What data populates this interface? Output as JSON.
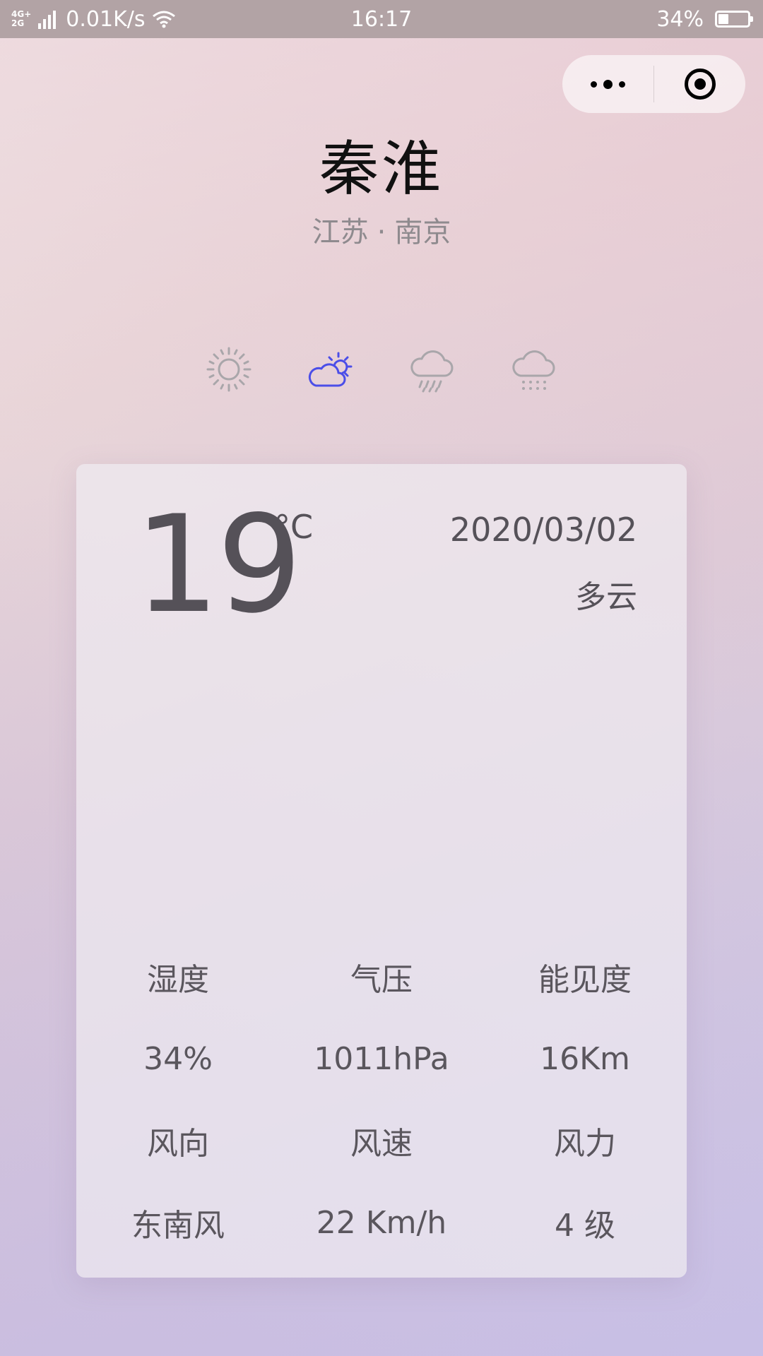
{
  "status_bar": {
    "network_type_top": "4G+",
    "network_type_bottom": "2G",
    "net_speed": "0.01K/s",
    "time": "16:17",
    "battery_percent": "34%",
    "battery_level": 0.34
  },
  "header": {
    "city": "秦淮",
    "province": "江苏",
    "separator": "·",
    "city_parent": "南京"
  },
  "weather_icons": [
    {
      "icon": "sun-icon",
      "active": false
    },
    {
      "icon": "partly-cloudy-icon",
      "active": true
    },
    {
      "icon": "rain-icon",
      "active": false
    },
    {
      "icon": "snow-icon",
      "active": false
    }
  ],
  "colors": {
    "active_icon": "#4b4ee8",
    "inactive_icon": "#a9a6aa",
    "text_main": "#555158"
  },
  "current": {
    "temperature": "19",
    "unit": "°C",
    "date": "2020/03/02",
    "description": "多云"
  },
  "details": {
    "labels_row1": [
      "湿度",
      "气压",
      "能见度"
    ],
    "values_row1": [
      "34%",
      "1011hPa",
      "16Km"
    ],
    "labels_row2": [
      "风向",
      "风速",
      "风力"
    ],
    "values_row2": [
      "东南风",
      "22 Km/h",
      "4 级"
    ]
  }
}
